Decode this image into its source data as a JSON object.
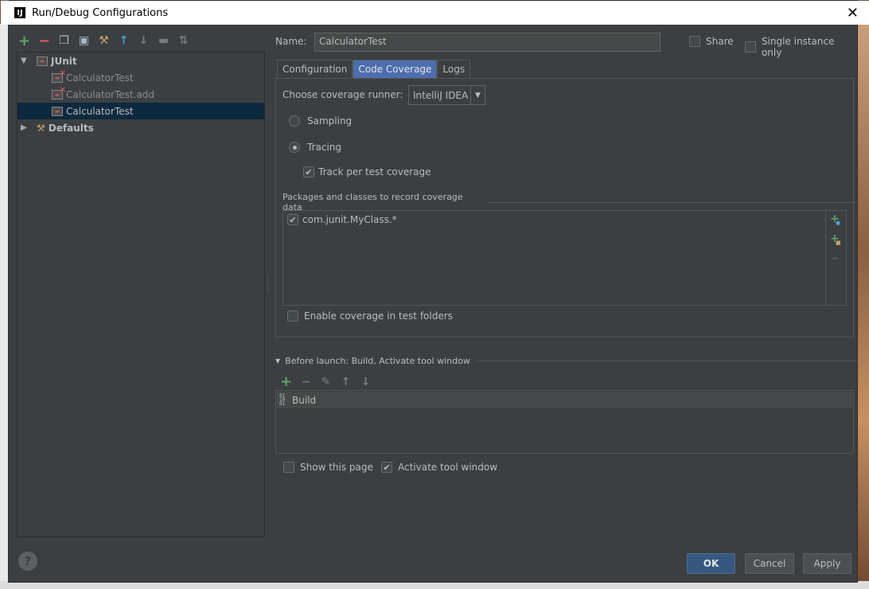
{
  "window": {
    "title": "Run/Debug Configurations",
    "app_icon": "IJ",
    "close_glyph": "✕"
  },
  "tree": {
    "root": "JUnit",
    "items": [
      "CalculatorTest",
      "CalculatorTest.add",
      "CalculatorTest"
    ],
    "defaults": "Defaults"
  },
  "form": {
    "name_label": "Name:",
    "name_value": "CalculatorTest",
    "share_label": "Share",
    "single_instance_label": "Single instance only",
    "tabs": [
      "Configuration",
      "Code Coverage",
      "Logs"
    ],
    "active_tab": "Code Coverage"
  },
  "coverage": {
    "runner_label": "Choose coverage runner:",
    "runner_value": "IntelliJ IDEA",
    "sampling_label": "Sampling",
    "tracing_label": "Tracing",
    "selected_mode": "Tracing",
    "track_label": "Track per test coverage",
    "track_checked": true,
    "packages_title": "Packages and classes to record coverage data",
    "packages": [
      {
        "name": "com.junit.MyClass.*",
        "checked": true
      }
    ],
    "enable_label": "Enable coverage in test folders",
    "enable_checked": false
  },
  "before_launch": {
    "title": "Before launch: Build, Activate tool window",
    "items": [
      "Build"
    ]
  },
  "footer": {
    "show_page_label": "Show this page",
    "show_page_checked": false,
    "activate_label": "Activate tool window",
    "activate_checked": true,
    "ok": "OK",
    "cancel": "Cancel",
    "apply": "Apply",
    "help": "?"
  },
  "colors": {
    "background": "#3c3f41",
    "selection": "#0d293e",
    "accent": "#4b6eaf",
    "ok_button": "#365880",
    "add_green": "#59a869",
    "remove_red": "#db5c5c"
  }
}
